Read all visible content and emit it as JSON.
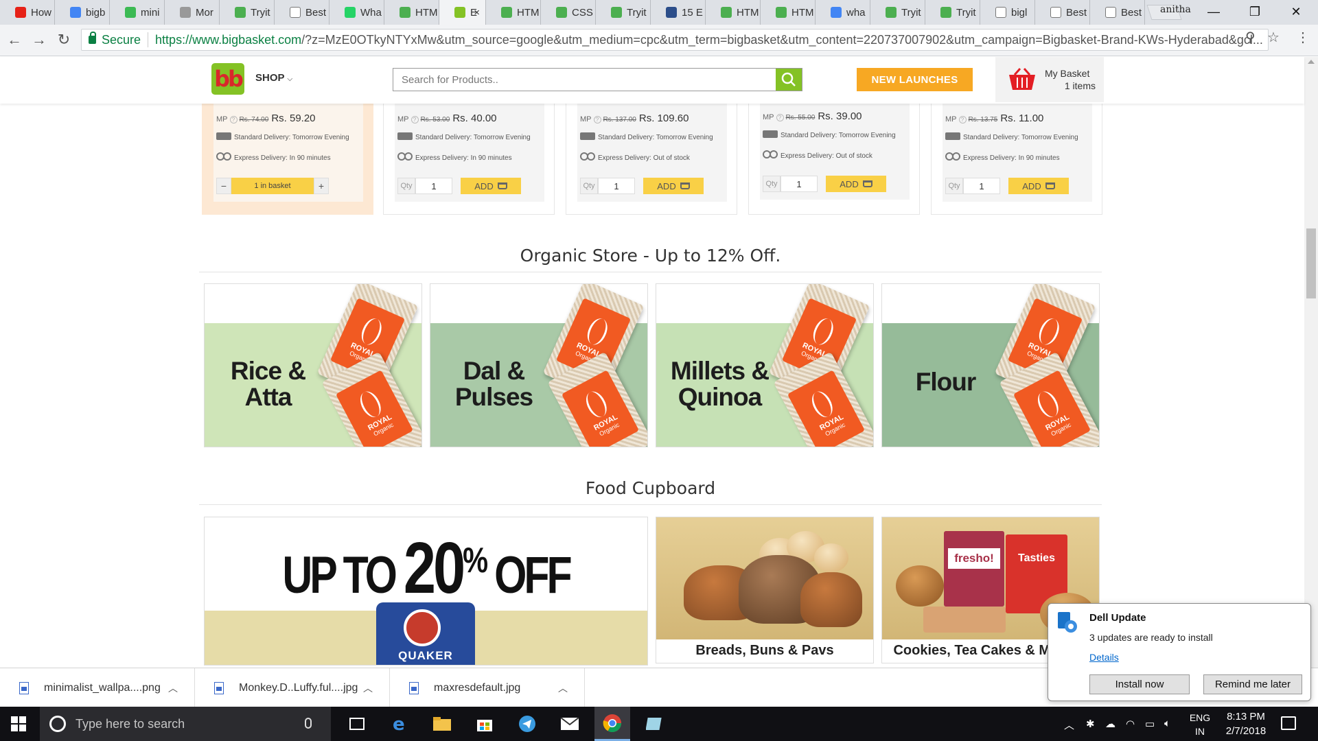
{
  "browser": {
    "tabs": [
      {
        "label": "How",
        "fav": "#e62117",
        "icon": "youtube-icon"
      },
      {
        "label": "bigb",
        "fav": "#4285f4",
        "icon": "google-icon"
      },
      {
        "label": "mini",
        "fav": "#3cba54",
        "icon": "bolt-icon"
      },
      {
        "label": "Mor",
        "fav": "#999999",
        "icon": "x-icon"
      },
      {
        "label": "Tryit",
        "fav": "#4caf50",
        "icon": "w3-icon"
      },
      {
        "label": "Best",
        "fav": "#ffffff",
        "icon": "page-icon"
      },
      {
        "label": "Wha",
        "fav": "#25d366",
        "icon": "whatsapp-icon"
      },
      {
        "label": "HTM",
        "fav": "#4caf50",
        "icon": "w3-icon"
      },
      {
        "label": "E",
        "fav": "#84c225",
        "icon": "bigbasket-icon",
        "active": true
      },
      {
        "label": "HTM",
        "fav": "#4caf50",
        "icon": "w3-icon"
      },
      {
        "label": "CSS",
        "fav": "#4caf50",
        "icon": "w3-icon"
      },
      {
        "label": "Tryit",
        "fav": "#4caf50",
        "icon": "w3-icon"
      },
      {
        "label": "15 E",
        "fav": "#2c4e8a",
        "icon": "shield-icon"
      },
      {
        "label": "HTM",
        "fav": "#4caf50",
        "icon": "w3-icon"
      },
      {
        "label": "HTM",
        "fav": "#4caf50",
        "icon": "w3-icon"
      },
      {
        "label": "wha",
        "fav": "#4285f4",
        "icon": "google-icon"
      },
      {
        "label": "Tryit",
        "fav": "#4caf50",
        "icon": "w3-icon"
      },
      {
        "label": "Tryit",
        "fav": "#4caf50",
        "icon": "w3-icon"
      },
      {
        "label": "bigl",
        "fav": "#ffffff",
        "icon": "page-icon"
      },
      {
        "label": "Best",
        "fav": "#ffffff",
        "icon": "page-icon"
      },
      {
        "label": "Best",
        "fav": "#ffffff",
        "icon": "page-icon"
      }
    ],
    "tab_close": "×",
    "profile": "anitha",
    "window": {
      "minimize": "—",
      "restore": "❐",
      "close": "✕"
    },
    "address": {
      "secure_label": "Secure",
      "url_host": "https://www.bigbasket.com",
      "url_rest": "/?z=MzE0OTkyNTYxMw&utm_source=google&utm_medium=cpc&utm_term=bigbasket&utm_content=220737007902&utm_campaign=Bigbasket-Brand-KWs-Hyderabad&gcl..."
    }
  },
  "site": {
    "logo_text": "bb",
    "shop_label": "SHOP",
    "search_placeholder": "Search for Products..",
    "new_launches": "NEW LAUNCHES",
    "basket_title": "My Basket",
    "basket_count": "1 items",
    "colors": {
      "brand_green": "#84c225",
      "orange": "#f7a823",
      "add_yellow": "#f9d046"
    }
  },
  "products": [
    {
      "mp": "MP",
      "mrp": "Rs. 74.00",
      "price": "Rs. 59.20",
      "standard": "Standard Delivery: Tomorrow Evening",
      "express": "Express Delivery: In 90 minutes",
      "in_basket": true,
      "basket_label": "1 in basket",
      "minus": "−",
      "plus": "+"
    },
    {
      "mp": "MP",
      "mrp": "Rs. 53.00",
      "price": "Rs. 40.00",
      "standard": "Standard Delivery: Tomorrow Evening",
      "express": "Express Delivery: In 90 minutes",
      "qty_label": "Qty",
      "qty": "1",
      "add": "ADD"
    },
    {
      "mp": "MP",
      "mrp": "Rs. 137.00",
      "price": "Rs. 109.60",
      "standard": "Standard Delivery: Tomorrow Evening",
      "express": "Express Delivery: Out of stock",
      "qty_label": "Qty",
      "qty": "1",
      "add": "ADD"
    },
    {
      "mp": "MP",
      "mrp": "Rs. 55.00",
      "price": "Rs. 39.00",
      "standard": "Standard Delivery: Tomorrow Evening",
      "express": "Express Delivery: Out of stock",
      "qty_label": "Qty",
      "qty": "1",
      "add": "ADD"
    },
    {
      "mp": "MP",
      "mrp": "Rs. 13.75",
      "price": "Rs. 11.00",
      "standard": "Standard Delivery: Tomorrow Evening",
      "express": "Express Delivery: In 90 minutes",
      "qty_label": "Qty",
      "qty": "1",
      "add": "ADD"
    }
  ],
  "organic": {
    "title": "Organic Store - Up to 12% Off.",
    "tiles": [
      {
        "line1": "Rice &",
        "line2": "Atta",
        "band": "#cfe5b8"
      },
      {
        "line1": "Dal &",
        "line2": "Pulses",
        "band": "#a9c9a7"
      },
      {
        "line1": "Millets &",
        "line2": "Quinoa",
        "band": "#c6e1b5"
      },
      {
        "line1": "Flour",
        "line2": "",
        "band": "#96bb99"
      }
    ],
    "pack_brand": "ROYAL",
    "pack_sub": "Organic"
  },
  "cupboard": {
    "title": "Food Cupboard",
    "promo": {
      "upto": "UP TO",
      "num": "20",
      "pct": "%",
      "off": "OFF",
      "brand": "QUAKER"
    },
    "tiles": [
      {
        "caption": "Breads, Buns & Pavs"
      },
      {
        "caption": "Cookies, Tea Cakes & Muffins",
        "box1": "fresho!",
        "box2": "Tasties"
      }
    ]
  },
  "downloads": [
    {
      "name": "minimalist_wallpa....png"
    },
    {
      "name": "Monkey.D..Luffy.ful....jpg"
    },
    {
      "name": "maxresdefault.jpg"
    }
  ],
  "toast": {
    "title": "Dell Update",
    "message": "3 updates are ready to install",
    "details": "Details",
    "install": "Install now",
    "remind": "Remind me later"
  },
  "taskbar": {
    "search_placeholder": "Type here to search",
    "lang1": "ENG",
    "lang2": "IN",
    "time": "8:13 PM",
    "date": "2/7/2018"
  }
}
